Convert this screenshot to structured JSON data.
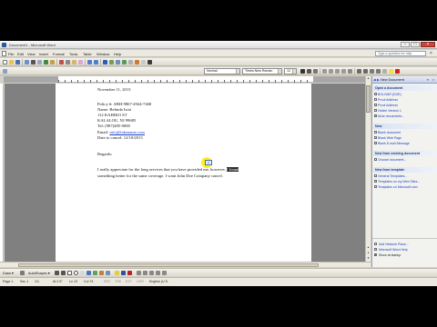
{
  "window": {
    "title": "Document1 - Microsoft Word",
    "buttons": {
      "minimize": "–",
      "maximize": "□",
      "close": "×"
    }
  },
  "menubar": {
    "items": [
      "File",
      "Edit",
      "View",
      "Insert",
      "Format",
      "Tools",
      "Table",
      "Window",
      "Help"
    ],
    "help_placeholder": "Type a question for help",
    "close_x": "×"
  },
  "toolbar": {
    "style": "Normal",
    "font": "Times New Roman",
    "size": "12"
  },
  "document": {
    "date": "November 11, 2013",
    "policy": "Policy #: ABH-9867-4944-7468",
    "name": "Name: Belinda Iwai",
    "address1": "112 KAHIKO ST",
    "address2": "KALALOU, NJ 99685",
    "tel": "Tel: (987)485-0000",
    "email_label": "Email:",
    "email_value": "info@fakename.com",
    "cancel_date": "Date to cancel: 12/10/2013",
    "salutation": "Regards:",
    "body1_before": "I really appreciate for the long services that you have provided me, however, ",
    "body1_selected": "I found",
    "body2": "something better for the same coverage. I want John Doe Company cancel.",
    "autocorrect_label": "A"
  },
  "drawbar": {
    "draw": "Draw ▾",
    "autoshapes": "AutoShapes ▾"
  },
  "statusbar": {
    "page": "Page 1",
    "sec": "Sec 1",
    "pages": "1/1",
    "at": "At 2.5\"",
    "ln": "Ln 13",
    "col": "Col 74",
    "rec": "REC",
    "trk": "TRK",
    "ext": "EXT",
    "ovr": "OVR",
    "language": "English (U.S."
  },
  "taskpane": {
    "title": "New Document",
    "sections": {
      "open": "Open a document",
      "new": "New",
      "existing": "New from existing document",
      "templates": "New from template"
    },
    "open_items": [
      "BOLIVAR (DOE)",
      "Proof Address",
      "Proof Address",
      "Holder Version 1",
      "More documents..."
    ],
    "new_items": [
      "Blank document",
      "Blank Web Page",
      "Blank E-mail Message"
    ],
    "existing_items": [
      "Choose document..."
    ],
    "template_items": [
      "General Templates...",
      "Templates on my Web Sites...",
      "Templates on Microsoft.com"
    ],
    "bottom_items": [
      "Add Network Place...",
      "Microsoft Word Help",
      "Show at startup"
    ]
  },
  "colors": {
    "accent": "#1a3fcf",
    "selection": "#2b2b2b",
    "highlight": "#ffec00"
  }
}
